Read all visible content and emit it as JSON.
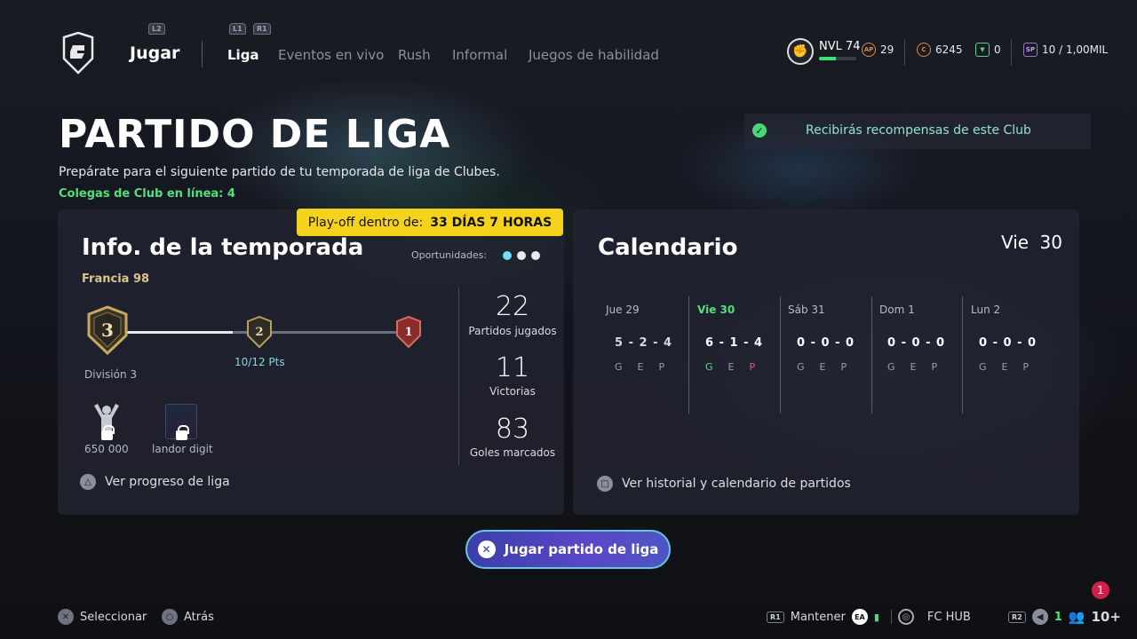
{
  "nav": {
    "main": "Jugar",
    "triggers": {
      "l2": "L2",
      "l1": "L1",
      "r1": "R1"
    },
    "tabs": [
      "Liga",
      "Eventos en vivo",
      "Rush",
      "Informal",
      "Juegos de habilidad"
    ],
    "active_tab": "Liga"
  },
  "status": {
    "level": "NVL 74",
    "level_progress": 0.45,
    "ap": "29",
    "coins": "6245",
    "tokens": "0",
    "sp": "10 / 1,00MIL",
    "ap_icon_text": "AP",
    "sp_icon_text": "SP"
  },
  "header": {
    "title": "PARTIDO DE LIGA",
    "subtitle": "Prepárate para el siguiente partido de tu temporada de liga de Clubes.",
    "online": "Colegas de Club en línea: 4",
    "reward_notice": "Recibirás recompensas de este Club"
  },
  "season": {
    "title": "Info. de la temporada",
    "playoff_label": "Play-off dentro de:",
    "playoff_value": "33 DÍAS 7 HORAS",
    "club": "Francia 98",
    "opportunities_label": "Oportunidades:",
    "division_current": "3",
    "division_current_label": "División 3",
    "division_next": "2",
    "division_next_pts": "10/12 Pts",
    "division_top": "1",
    "reward1_label": "650 000",
    "reward2_label": "landor digit",
    "matches_played": "22",
    "matches_played_label": "Partidos jugados",
    "wins": "11",
    "wins_label": "Victorias",
    "goals": "83",
    "goals_label": "Goles marcados",
    "action": "Ver progreso de liga"
  },
  "calendar": {
    "title": "Calendario",
    "today_day": "Vie",
    "today_num": "30",
    "days": [
      {
        "label": "Jue 29",
        "score": "5 - 2 - 4"
      },
      {
        "label": "Vie 30",
        "score": "6 - 1 - 4"
      },
      {
        "label": "Sáb 31",
        "score": "0 - 0 - 0"
      },
      {
        "label": "Dom 1",
        "score": "0 - 0 - 0"
      },
      {
        "label": "Lun 2",
        "score": "0 - 0 - 0"
      }
    ],
    "gep": [
      "G",
      "E",
      "P"
    ],
    "action": "Ver historial y calendario de partidos"
  },
  "play_button": "Jugar partido de liga",
  "footer": {
    "select": "Seleccionar",
    "back": "Atrás",
    "r1": "R1",
    "hold": "Mantener",
    "ea": "EA",
    "hub": "FC HUB",
    "r2": "R2",
    "voice_count": "1",
    "players": "10+",
    "notifications": "1"
  },
  "colors": {
    "accent_green": "#52e07a",
    "playoff_yellow": "#f5d31c",
    "button_purple": "#5a47c8",
    "win_green": "#52e07a",
    "loss_red": "#e05a5a"
  }
}
